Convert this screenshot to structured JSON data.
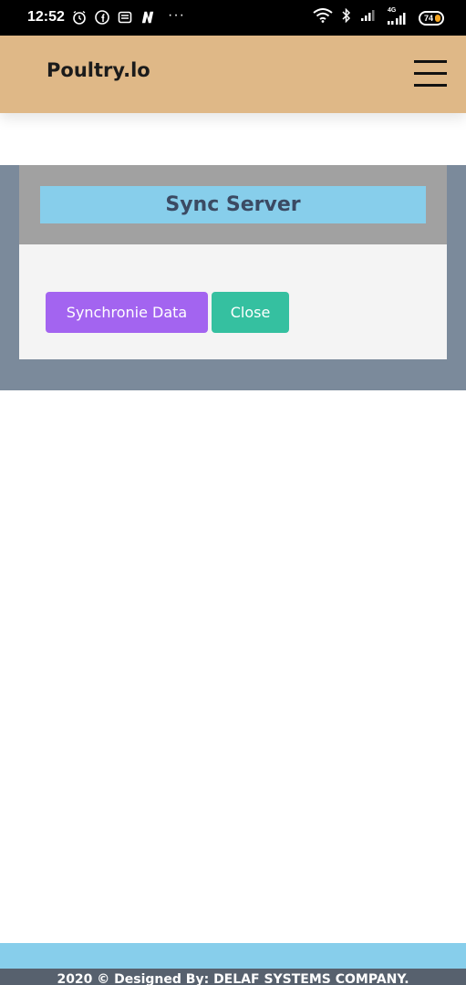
{
  "status_bar": {
    "time": "12:52",
    "overflow_dots": "···",
    "network_label": "4G",
    "battery_level": "74"
  },
  "header": {
    "brand": "Poultry.lo"
  },
  "modal": {
    "title": "Sync Server",
    "sync_button_label": "Synchronie Data",
    "close_button_label": "Close"
  },
  "footer": {
    "text": "2020 © Designed By: DELAF SYSTEMS COMPANY."
  },
  "colors": {
    "header_bg": "#dfb887",
    "overlay_bg": "#7b8a9b",
    "modal_header_bg": "#a1a1a1",
    "title_bg": "#87ceeb",
    "sync_button": "#a364f0",
    "close_button": "#35c0a0",
    "footer_strip": "#87ceeb",
    "footer_bar": "#57616e"
  }
}
